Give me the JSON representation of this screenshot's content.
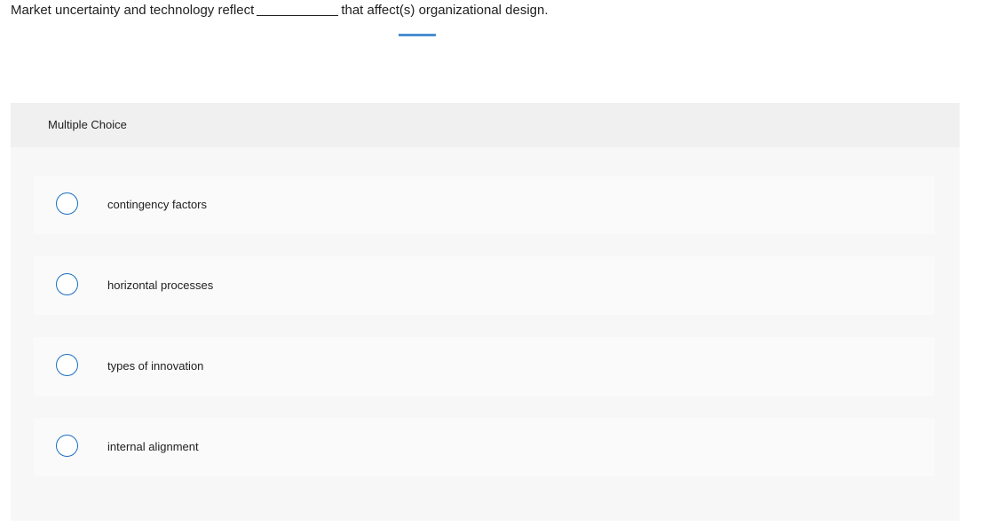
{
  "question": {
    "before_blank": "Market uncertainty and technology reflect",
    "after_blank": "that affect(s) organizational design."
  },
  "multiple_choice": {
    "header": "Multiple Choice",
    "options": [
      {
        "label": "contingency factors",
        "selected": false
      },
      {
        "label": "horizontal processes",
        "selected": false
      },
      {
        "label": "types of innovation",
        "selected": false
      },
      {
        "label": "internal alignment",
        "selected": false
      }
    ]
  },
  "colors": {
    "radio_border": "#1a6fc4",
    "focus_indicator": "#4a8ed0",
    "panel_background": "#f7f7f7",
    "header_background": "#f0f0f0",
    "option_background": "#fafafa"
  }
}
